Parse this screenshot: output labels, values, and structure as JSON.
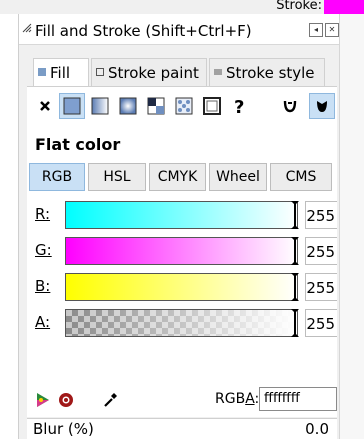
{
  "top": {
    "stroke_label": "Stroke:",
    "stroke_color": "#ff00ff"
  },
  "panel": {
    "title": "Fill and Stroke (Shift+Ctrl+F)"
  },
  "tabs": [
    {
      "label": "Fill",
      "active": true
    },
    {
      "label": "Stroke paint",
      "active": false
    },
    {
      "label": "Stroke style",
      "active": false
    }
  ],
  "paint_types": [
    "no-paint",
    "flat-color",
    "linear-gradient",
    "radial-gradient",
    "mesh-gradient",
    "pattern",
    "swatch",
    "unset"
  ],
  "fill_rule": [
    "evenodd",
    "nonzero"
  ],
  "section_title": "Flat color",
  "color_modes": [
    {
      "label": "RGB",
      "active": true
    },
    {
      "label": "HSL",
      "active": false
    },
    {
      "label": "CMYK",
      "active": false
    },
    {
      "label": "Wheel",
      "active": false
    },
    {
      "label": "CMS",
      "active": false
    }
  ],
  "channels": [
    {
      "label": "R:",
      "value": "255",
      "start": "#00ffff",
      "end": "#ffffff"
    },
    {
      "label": "G:",
      "value": "255",
      "start": "#ff00ff",
      "end": "#ffffff"
    },
    {
      "label": "B:",
      "value": "255",
      "start": "#ffff00",
      "end": "#ffffff"
    },
    {
      "label": "A:",
      "value": "255",
      "start": "checker",
      "end": "#ffffff"
    }
  ],
  "rgba": {
    "label_prefix": "RGB",
    "label_underlined": "A",
    "label_suffix": ":",
    "value": "ffffffff"
  },
  "blur": {
    "label": "Blur (%)",
    "value": "0.0"
  }
}
